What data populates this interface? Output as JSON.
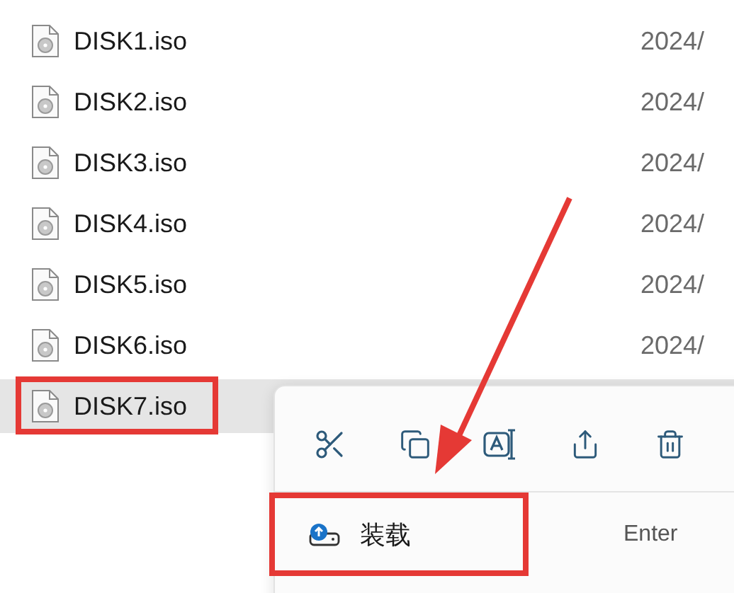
{
  "files": [
    {
      "name": "DISK1.iso",
      "date": "2024/",
      "selected": false
    },
    {
      "name": "DISK2.iso",
      "date": "2024/",
      "selected": false
    },
    {
      "name": "DISK3.iso",
      "date": "2024/",
      "selected": false
    },
    {
      "name": "DISK4.iso",
      "date": "2024/",
      "selected": false
    },
    {
      "name": "DISK5.iso",
      "date": "2024/",
      "selected": false
    },
    {
      "name": "DISK6.iso",
      "date": "2024/",
      "selected": false
    },
    {
      "name": "DISK7.iso",
      "selected": true
    }
  ],
  "context_menu": {
    "toolbar": [
      {
        "kind": "cut"
      },
      {
        "kind": "copy"
      },
      {
        "kind": "rename"
      },
      {
        "kind": "share"
      },
      {
        "kind": "delete"
      }
    ],
    "items": [
      {
        "label": "装载",
        "shortcut": "Enter"
      }
    ]
  }
}
